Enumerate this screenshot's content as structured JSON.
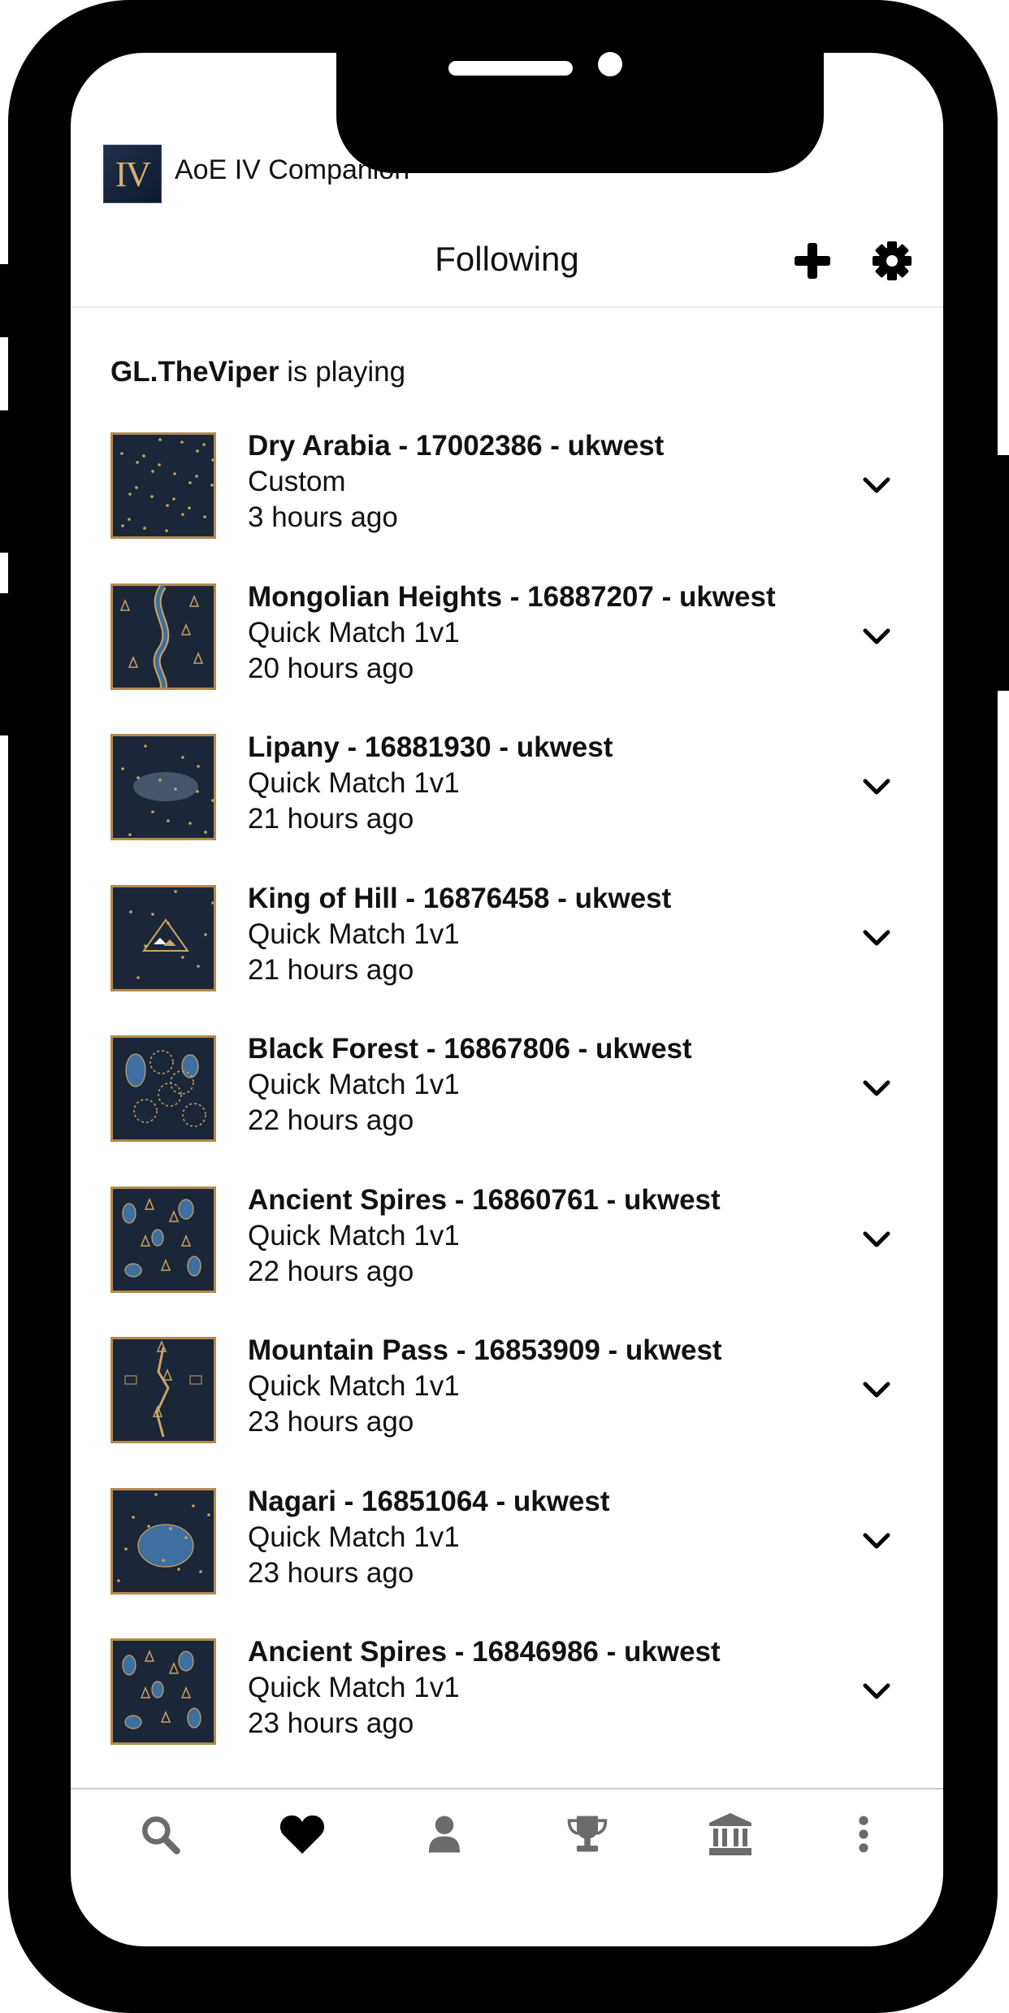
{
  "app": {
    "title": "AoE IV Companion",
    "icon_text": "IV"
  },
  "header": {
    "title": "Following"
  },
  "status": {
    "player": "GL.TheViper",
    "suffix": " is playing"
  },
  "matches": [
    {
      "title": "Dry Arabia - 17002386 - ukwest",
      "mode": "Custom",
      "time": "3 hours ago",
      "map": "dry-arabia"
    },
    {
      "title": "Mongolian Heights - 16887207 - ukwest",
      "mode": "Quick Match 1v1",
      "time": "20 hours ago",
      "map": "mongolian-heights"
    },
    {
      "title": "Lipany - 16881930 - ukwest",
      "mode": "Quick Match 1v1",
      "time": "21 hours ago",
      "map": "lipany"
    },
    {
      "title": "King of Hill - 16876458 - ukwest",
      "mode": "Quick Match 1v1",
      "time": "21 hours ago",
      "map": "king-of-hill"
    },
    {
      "title": "Black Forest - 16867806 - ukwest",
      "mode": "Quick Match 1v1",
      "time": "22 hours ago",
      "map": "black-forest"
    },
    {
      "title": "Ancient Spires - 16860761 - ukwest",
      "mode": "Quick Match 1v1",
      "time": "22 hours ago",
      "map": "ancient-spires"
    },
    {
      "title": "Mountain Pass - 16853909 - ukwest",
      "mode": "Quick Match 1v1",
      "time": "23 hours ago",
      "map": "mountain-pass"
    },
    {
      "title": "Nagari - 16851064 - ukwest",
      "mode": "Quick Match 1v1",
      "time": "23 hours ago",
      "map": "nagari"
    },
    {
      "title": "Ancient Spires - 16846986 - ukwest",
      "mode": "Quick Match 1v1",
      "time": "23 hours ago",
      "map": "ancient-spires"
    }
  ],
  "nav": [
    {
      "name": "search",
      "icon": "search-icon",
      "active": false
    },
    {
      "name": "following",
      "icon": "heart-icon",
      "active": true
    },
    {
      "name": "profile",
      "icon": "user-icon",
      "active": false
    },
    {
      "name": "leaderboard",
      "icon": "trophy-icon",
      "active": false
    },
    {
      "name": "civilizations",
      "icon": "building-icon",
      "active": false
    },
    {
      "name": "more",
      "icon": "more-vertical-icon",
      "active": false
    }
  ],
  "colors": {
    "active": "#000000",
    "inactive": "#6b6b6b",
    "thumb_border": "#b48a4e",
    "thumb_bg": "#1b2638",
    "gold": "#c9a463",
    "water": "#3f6fa0"
  }
}
